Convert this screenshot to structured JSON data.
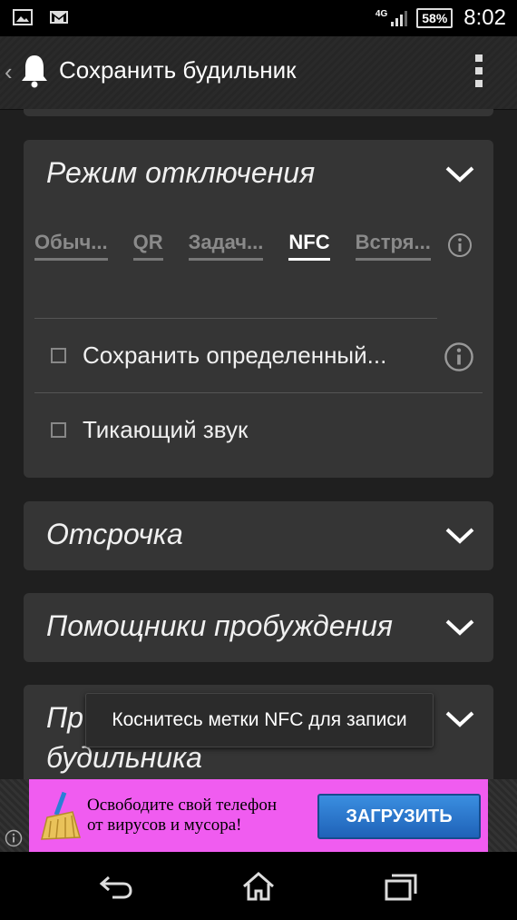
{
  "status_bar": {
    "network_label": "4G",
    "battery": "58%",
    "time": "8:02",
    "icons": [
      "image-icon",
      "gmail-icon",
      "signal-icon"
    ]
  },
  "action_bar": {
    "title": "Сохранить будильник",
    "icons": [
      "back-caret-icon",
      "bell-icon",
      "overflow-menu-icon"
    ]
  },
  "dismiss_card": {
    "title": "Режим отключения",
    "tabs": [
      {
        "label": "Обыч...",
        "active": false
      },
      {
        "label": "QR",
        "active": false
      },
      {
        "label": "Задач...",
        "active": false
      },
      {
        "label": "NFC",
        "active": true
      },
      {
        "label": "Встря...",
        "active": false
      }
    ],
    "options": [
      {
        "label": "Сохранить определенный...",
        "checked": false,
        "has_info": true
      },
      {
        "label": "Тикающий звук",
        "checked": false,
        "has_info": false
      }
    ]
  },
  "snooze_card": {
    "title": "Отсрочка"
  },
  "wakeup_card": {
    "title": "Помощники пробуждения"
  },
  "partial_card": {
    "title_line1": "Пр",
    "title_line2": "будильника"
  },
  "toast": {
    "text": "Коснитесь метки NFC для записи"
  },
  "ad": {
    "line1": "Освободите свой телефон",
    "line2": "от вирусов и мусора!",
    "button": "ЗАГРУЗИТЬ",
    "colors": {
      "background": "#f05cf0",
      "button": "#2a78d0"
    }
  },
  "nav_bar": {
    "icons": [
      "back-icon",
      "home-icon",
      "recents-icon"
    ]
  }
}
